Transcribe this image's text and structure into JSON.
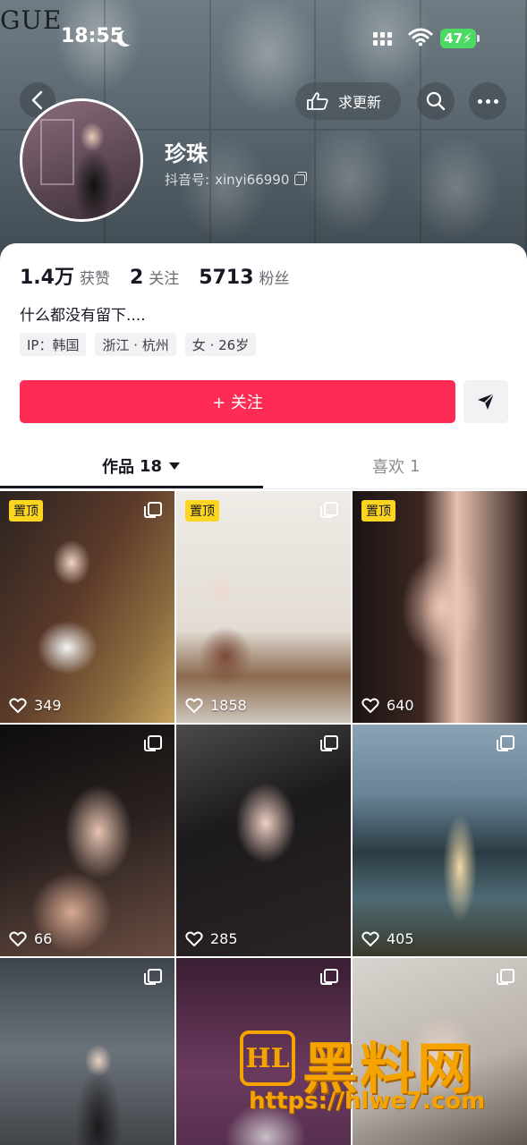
{
  "status_bar": {
    "time": "18:55",
    "battery": "47"
  },
  "banner": {
    "text": "GUE"
  },
  "nav": {
    "update_label": "求更新"
  },
  "profile": {
    "name": "珍珠",
    "id_label": "抖音号: ",
    "id_value": "xinyi66990"
  },
  "stats": [
    {
      "value": "1.4万",
      "label": "获赞"
    },
    {
      "value": "2",
      "label": "关注"
    },
    {
      "value": "5713",
      "label": "粉丝"
    }
  ],
  "bio": "什么都没有留下....",
  "tags": [
    "IP：韩国",
    "浙江 · 杭州",
    "女 · 26岁"
  ],
  "follow_label": "+ 关注",
  "tabs": {
    "works_label": "作品",
    "works_count": "18",
    "likes_label": "喜欢",
    "likes_count": "1"
  },
  "pin_label": "置顶",
  "videos": [
    {
      "likes": "349",
      "pinned": true
    },
    {
      "likes": "1858",
      "pinned": true
    },
    {
      "likes": "640",
      "pinned": true
    },
    {
      "likes": "66",
      "pinned": false
    },
    {
      "likes": "285",
      "pinned": false
    },
    {
      "likes": "405",
      "pinned": false
    },
    {
      "likes": "",
      "pinned": false
    },
    {
      "likes": "",
      "pinned": false
    },
    {
      "likes": "",
      "pinned": false
    }
  ],
  "watermark": {
    "logo": "HL",
    "title": "黑料网",
    "url": "https://hlwe7.com"
  },
  "colors": {
    "follow": "#fe2c55",
    "pin_badge": "#fbd51f",
    "watermark": "#f5a300"
  }
}
